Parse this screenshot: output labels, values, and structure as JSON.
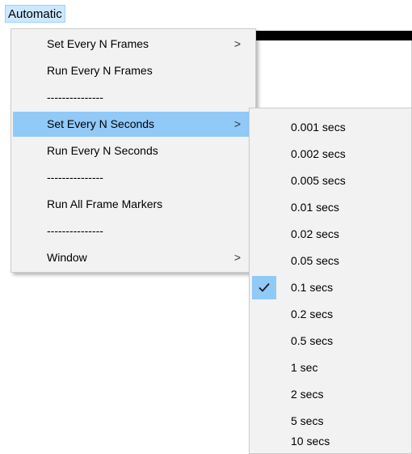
{
  "menubar": {
    "items": [
      {
        "label": "Automatic"
      }
    ]
  },
  "main_menu": {
    "items": [
      {
        "label": "Set Every N Frames",
        "submenu": true
      },
      {
        "label": "Run Every N Frames"
      },
      {
        "label": "---------------"
      },
      {
        "label": "Set Every N Seconds",
        "submenu": true,
        "highlighted": true
      },
      {
        "label": "Run Every N Seconds"
      },
      {
        "label": "---------------"
      },
      {
        "label": "Run All Frame Markers"
      },
      {
        "label": "---------------"
      },
      {
        "label": "Window",
        "submenu": true
      }
    ],
    "submenu_arrow": ">"
  },
  "seconds_submenu": {
    "checked_value": "0.1 secs",
    "items": [
      {
        "label": "0.001 secs"
      },
      {
        "label": "0.002 secs"
      },
      {
        "label": "0.005 secs"
      },
      {
        "label": "0.01 secs"
      },
      {
        "label": "0.02 secs"
      },
      {
        "label": "0.05 secs"
      },
      {
        "label": "0.1 secs",
        "checked": true
      },
      {
        "label": "0.2 secs"
      },
      {
        "label": "0.5 secs"
      },
      {
        "label": "1 sec"
      },
      {
        "label": "2 secs"
      },
      {
        "label": "5 secs"
      },
      {
        "label": "10 secs"
      }
    ]
  },
  "colors": {
    "highlight": "#91c9f7",
    "menubar_active": "#cce8ff",
    "menu_background": "#f2f2f2"
  },
  "icons": {
    "check": "checkmark-icon",
    "submenu": "chevron-right-icon"
  }
}
